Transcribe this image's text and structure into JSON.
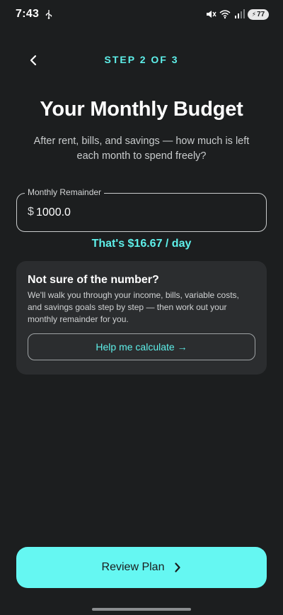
{
  "status_bar": {
    "time": "7:43",
    "battery_level": "77",
    "icons": [
      "usb-icon",
      "mute-icon",
      "wifi-icon",
      "signal-icon",
      "battery-icon"
    ]
  },
  "header": {
    "step_label": "STEP 2 OF 3",
    "back_icon": "chevron-left-icon"
  },
  "title": "Your Monthly Budget",
  "subtitle": "After rent, bills, and savings — how much is left each month to spend freely?",
  "remainder_field": {
    "label": "Monthly Remainder",
    "currency_prefix": "$",
    "value": "1000.0"
  },
  "per_day_text": "That's $16.67 / day",
  "helper_card": {
    "title": "Not sure of the number?",
    "body": "We'll walk you through your income, bills, variable costs, and savings goals step by step — then work out your monthly remainder for you.",
    "button_label": "Help me calculate →"
  },
  "primary_button": {
    "label": "Review Plan",
    "icon": "chevron-right-icon"
  },
  "colors": {
    "background": "#1c1e1f",
    "accent": "#5ef0ea",
    "button_fill": "#65f7f2",
    "card": "#2b2d2f"
  }
}
